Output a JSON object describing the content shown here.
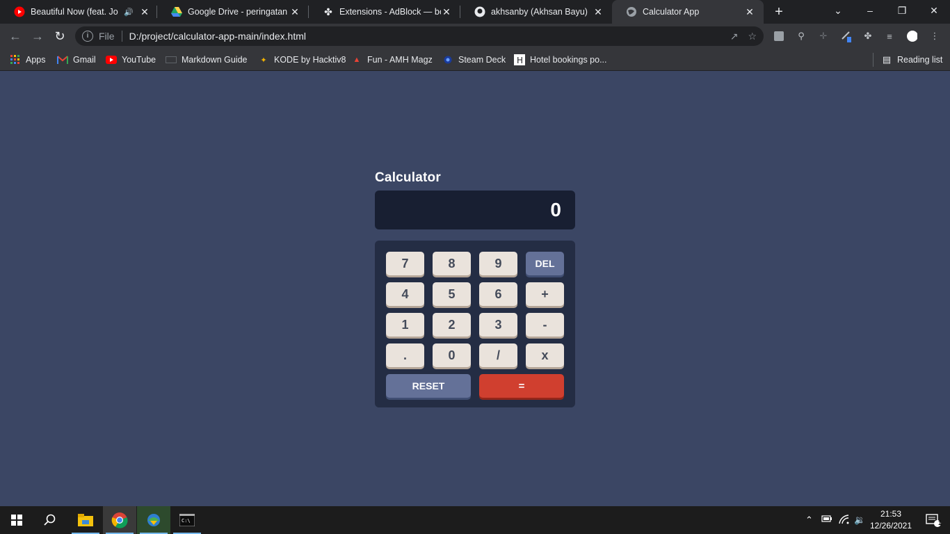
{
  "browser": {
    "tabs": [
      {
        "title": "Beautiful Now (feat. Jon Bellion)",
        "icon": "youtube-icon"
      },
      {
        "title": "Google Drive - peringatan peretasan",
        "icon": "google-drive-icon"
      },
      {
        "title": "Extensions - AdBlock — best ad blocker",
        "icon": "extension-puzzle-icon"
      },
      {
        "title": "akhsanby (Akhsan Bayu)",
        "icon": "github-icon"
      },
      {
        "title": "Calculator App",
        "icon": "globe-icon"
      }
    ],
    "address": {
      "scheme_label": "File",
      "url": "D:/project/calculator-app-main/index.html"
    },
    "bookmarks": [
      {
        "label": "Apps",
        "icon": "apps-grid-icon"
      },
      {
        "label": "Gmail",
        "icon": "gmail-icon"
      },
      {
        "label": "YouTube",
        "icon": "youtube-icon"
      },
      {
        "label": "Markdown Guide",
        "icon": "markdown-icon"
      },
      {
        "label": "KODE by Hacktiv8",
        "icon": "kode-icon"
      },
      {
        "label": "Fun - AMH Magz",
        "icon": "amh-icon"
      },
      {
        "label": "Steam Deck",
        "icon": "steam-icon"
      },
      {
        "label": "Hotel bookings po...",
        "icon": "hotel-icon"
      }
    ],
    "reading_list": "Reading list"
  },
  "app": {
    "title": "Calculator",
    "display": "0",
    "keys": {
      "k7": "7",
      "k8": "8",
      "k9": "9",
      "del": "DEL",
      "k4": "4",
      "k5": "5",
      "k6": "6",
      "plus": "+",
      "k1": "1",
      "k2": "2",
      "k3": "3",
      "minus": "-",
      "dot": ".",
      "k0": "0",
      "divide": "/",
      "multiply": "x",
      "reset": "RESET",
      "equals": "="
    },
    "colors": {
      "background": "#3b4664",
      "screen": "#181f32",
      "keypad": "#242d44",
      "key": "#eae3dc",
      "key_blue": "#647198",
      "key_red": "#d03f2f"
    }
  },
  "taskbar": {
    "time": "21:53",
    "date": "12/26/2021",
    "notification_count": "1"
  }
}
